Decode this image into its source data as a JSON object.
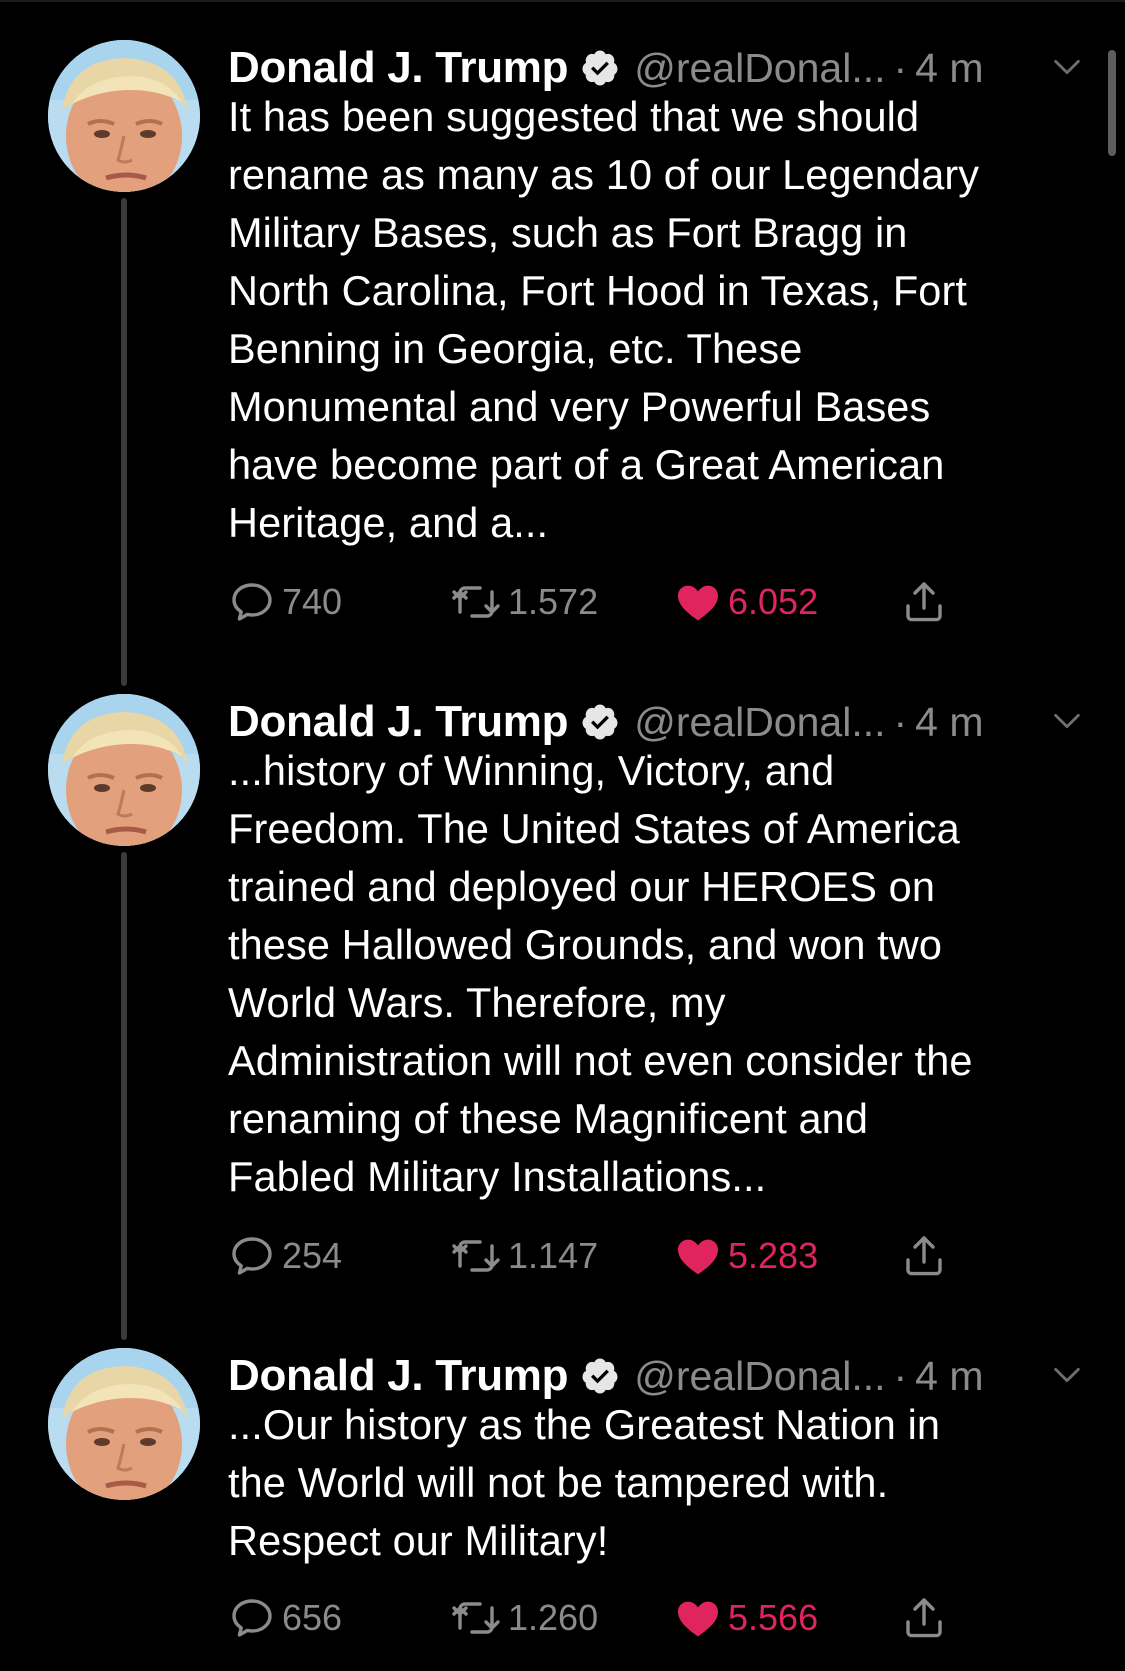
{
  "colors": {
    "background": "#000000",
    "text": "#ffffff",
    "muted": "#8b8b8b",
    "like": "#e0245e",
    "thread_line": "#3a3a3a"
  },
  "icons": {
    "verified": "verified-badge-icon",
    "chevron": "chevron-down-icon",
    "reply": "reply-bubble-icon",
    "retweet": "retweet-icon",
    "like": "heart-filled-icon",
    "share": "share-icon"
  },
  "tweets": [
    {
      "name": "Donald J. Trump",
      "handle": "@realDonal...",
      "separator": "·",
      "time": "4 m",
      "lines": [
        "It has been suggested that we should",
        "rename as many as 10 of our Legendary",
        "Military Bases, such as Fort Bragg in",
        "North Carolina, Fort Hood in Texas, Fort",
        "Benning in Georgia, etc. These",
        "Monumental and very Powerful Bases",
        "have become part of a Great American",
        "Heritage, and a..."
      ],
      "replies": "740",
      "retweets": "1.572",
      "likes": "6.052",
      "liked": true
    },
    {
      "name": "Donald J. Trump",
      "handle": "@realDonal...",
      "separator": "·",
      "time": "4 m",
      "lines": [
        "...history of Winning, Victory, and",
        "Freedom. The United States of America",
        "trained and deployed our HEROES on",
        "these Hallowed Grounds, and won two",
        "World Wars. Therefore, my",
        "Administration will not even consider the",
        "renaming of these Magnificent and",
        "Fabled Military Installations..."
      ],
      "replies": "254",
      "retweets": "1.147",
      "likes": "5.283",
      "liked": true
    },
    {
      "name": "Donald J. Trump",
      "handle": "@realDonal...",
      "separator": "·",
      "time": "4 m",
      "lines": [
        "...Our history as the Greatest Nation in",
        "the World will not be tampered with.",
        "Respect our Military!"
      ],
      "replies": "656",
      "retweets": "1.260",
      "likes": "5.566",
      "liked": true
    }
  ]
}
